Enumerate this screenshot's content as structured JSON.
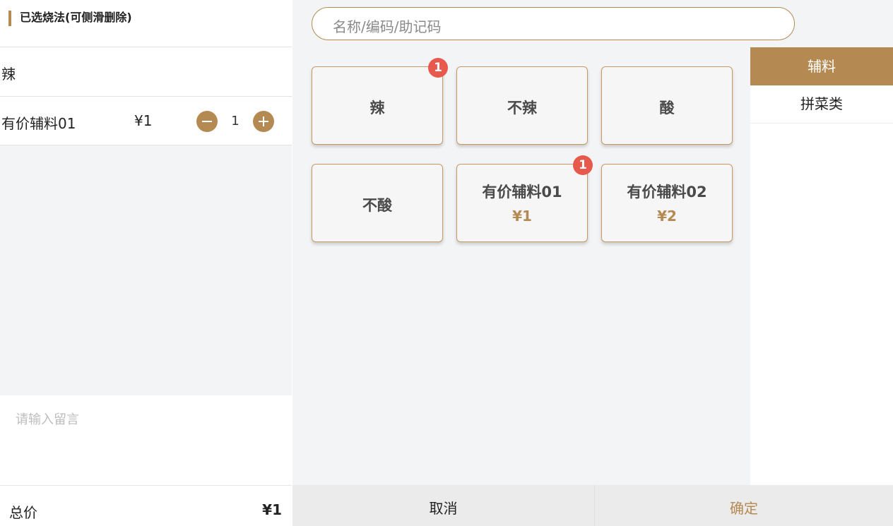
{
  "left_panel": {
    "title": "已选烧法(可侧滑删除)",
    "selected": [
      {
        "name": "辣"
      },
      {
        "name": "有价辅料01",
        "price": "¥1",
        "qty": "1"
      }
    ],
    "remark_placeholder": "请输入留言",
    "total_label": "总价",
    "total_amount": "¥1"
  },
  "search": {
    "placeholder": "名称/编码/助记码"
  },
  "items": [
    {
      "name": "辣",
      "badge": "1"
    },
    {
      "name": "不辣"
    },
    {
      "name": "酸"
    },
    {
      "name": "不酸"
    },
    {
      "name": "有价辅料01",
      "price": "¥1",
      "badge": "1"
    },
    {
      "name": "有价辅料02",
      "price": "¥2"
    }
  ],
  "categories": [
    {
      "label": "辅料",
      "active": true
    },
    {
      "label": "拼菜类",
      "active": false
    }
  ],
  "footer": {
    "cancel": "取消",
    "confirm": "确定"
  },
  "colors": {
    "accent": "#b58a52",
    "badge": "#e7584d",
    "panel_bg": "#f3f4f6"
  }
}
